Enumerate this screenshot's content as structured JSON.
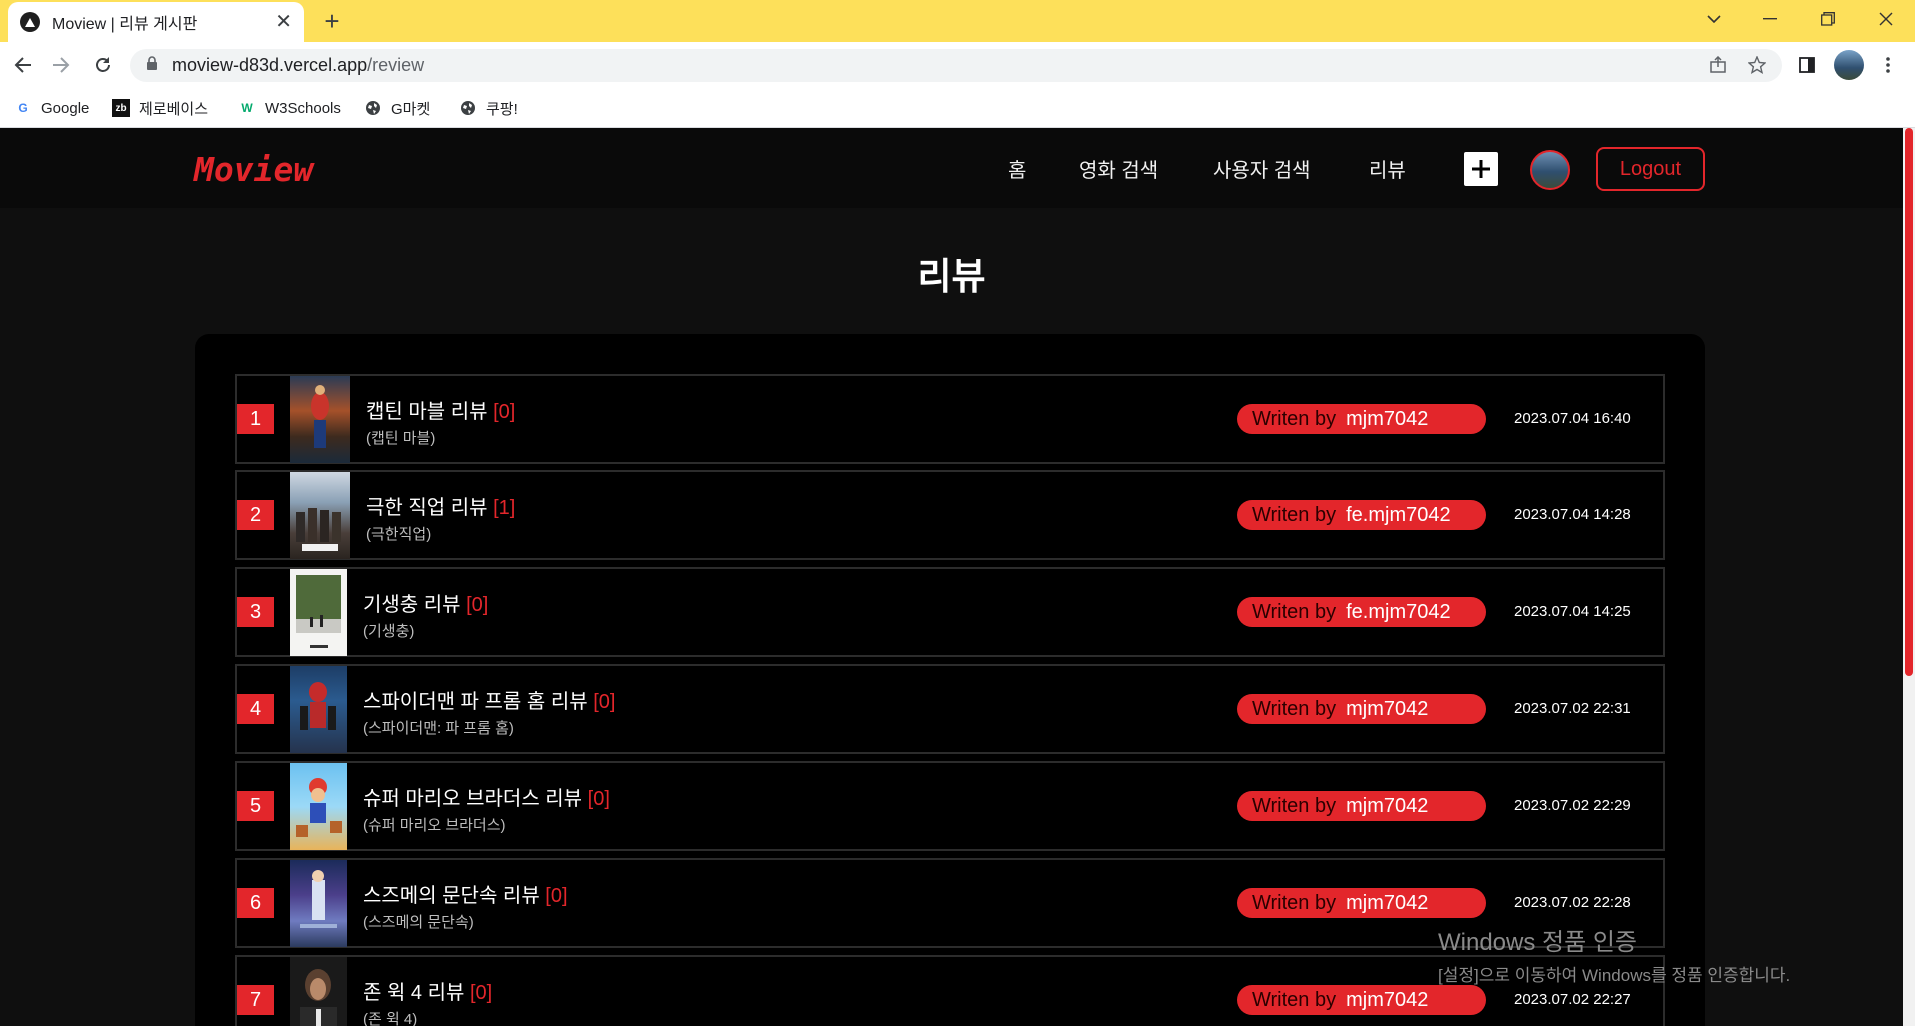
{
  "browser": {
    "tab_title": "Moview | 리뷰 게시판",
    "url_host": "moview-d83d.vercel.app",
    "url_path": "/review",
    "bookmarks": [
      {
        "label": "Google",
        "icon": "google-icon"
      },
      {
        "label": "제로베이스",
        "icon": "zerobase-icon"
      },
      {
        "label": "W3Schools",
        "icon": "w3schools-icon"
      },
      {
        "label": "G마켓",
        "icon": "globe-icon"
      },
      {
        "label": "쿠팡!",
        "icon": "globe-icon"
      }
    ]
  },
  "site": {
    "logo": "Moview",
    "nav": [
      "홈",
      "영화 검색",
      "사용자 검색",
      "리뷰"
    ],
    "logout_label": "Logout",
    "accent_color": "#e3262b"
  },
  "page": {
    "title": "리뷰"
  },
  "reviews": [
    {
      "num": "1",
      "title": "캡틴 마블 리뷰",
      "comments": "[0]",
      "movie": "(캡틴 마블)",
      "writer_label": "Writen by",
      "writer": "mjm7042",
      "date": "2023.07.04 16:40"
    },
    {
      "num": "2",
      "title": "극한 직업 리뷰",
      "comments": "[1]",
      "movie": "(극한직업)",
      "writer_label": "Writen by",
      "writer": "fe.mjm7042",
      "date": "2023.07.04 14:28"
    },
    {
      "num": "3",
      "title": "기생충 리뷰",
      "comments": "[0]",
      "movie": "(기생충)",
      "writer_label": "Writen by",
      "writer": "fe.mjm7042",
      "date": "2023.07.04 14:25"
    },
    {
      "num": "4",
      "title": "스파이더맨 파 프롬 홈 리뷰",
      "comments": "[0]",
      "movie": "(스파이더맨: 파 프롬 홈)",
      "writer_label": "Writen by",
      "writer": "mjm7042",
      "date": "2023.07.02 22:31"
    },
    {
      "num": "5",
      "title": "슈퍼 마리오 브라더스 리뷰",
      "comments": "[0]",
      "movie": "(슈퍼 마리오 브라더스)",
      "writer_label": "Writen by",
      "writer": "mjm7042",
      "date": "2023.07.02 22:29"
    },
    {
      "num": "6",
      "title": "스즈메의 문단속 리뷰",
      "comments": "[0]",
      "movie": "(스즈메의 문단속)",
      "writer_label": "Writen by",
      "writer": "mjm7042",
      "date": "2023.07.02 22:28"
    },
    {
      "num": "7",
      "title": "존 윅 4 리뷰",
      "comments": "[0]",
      "movie": "(존 윅 4)",
      "writer_label": "Writen by",
      "writer": "mjm7042",
      "date": "2023.07.02 22:27"
    }
  ],
  "watermark": {
    "title": "Windows 정품 인증",
    "subtitle": "[설정]으로 이동하여 Windows를 정품 인증합니다."
  }
}
